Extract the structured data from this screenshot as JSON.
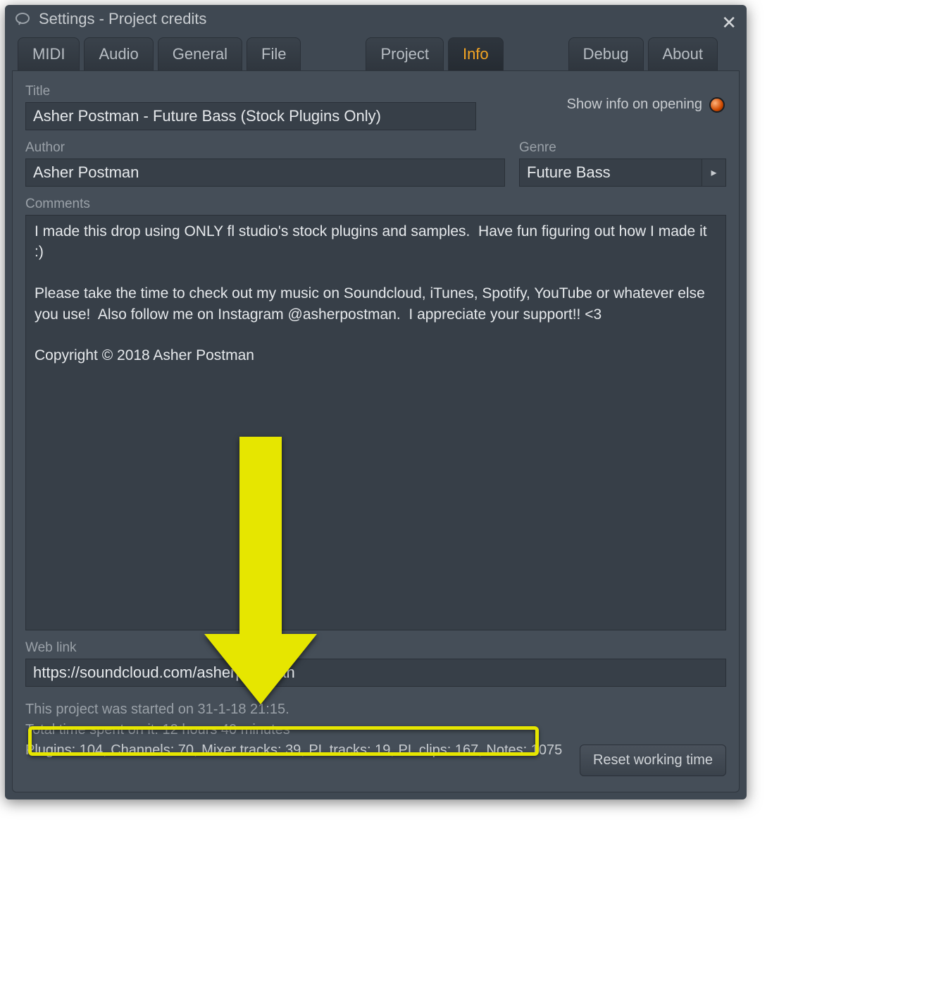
{
  "window": {
    "title": "Settings - Project credits"
  },
  "tabs": {
    "midi": "MIDI",
    "audio": "Audio",
    "general": "General",
    "file": "File",
    "project": "Project",
    "info": "Info",
    "debug": "Debug",
    "about": "About"
  },
  "labels": {
    "title": "Title",
    "author": "Author",
    "genre": "Genre",
    "comments": "Comments",
    "weblink": "Web link",
    "showinfo": "Show info on opening"
  },
  "fields": {
    "title": "Asher Postman - Future Bass (Stock Plugins Only)",
    "author": "Asher Postman",
    "genre": "Future Bass",
    "comments": "I made this drop using ONLY fl studio's stock plugins and samples.  Have fun figuring out how I made it :)\n\nPlease take the time to check out my music on Soundcloud, iTunes, Spotify, YouTube or whatever else you use!  Also follow me on Instagram @asherpostman.  I appreciate your support!! <3\n\nCopyright © 2018 Asher Postman",
    "weblink": "https://soundcloud.com/asherpostman"
  },
  "footer": {
    "started": "This project was started on 31-1-18 21:15.",
    "timespent": "Total time spent on it: 12 hours 40 minutes",
    "stats": "Plugins: 104, Channels: 70, Mixer tracks: 39, PL tracks: 19, PL clips: 167, Notes: 1075"
  },
  "buttons": {
    "reset": "Reset working time"
  }
}
